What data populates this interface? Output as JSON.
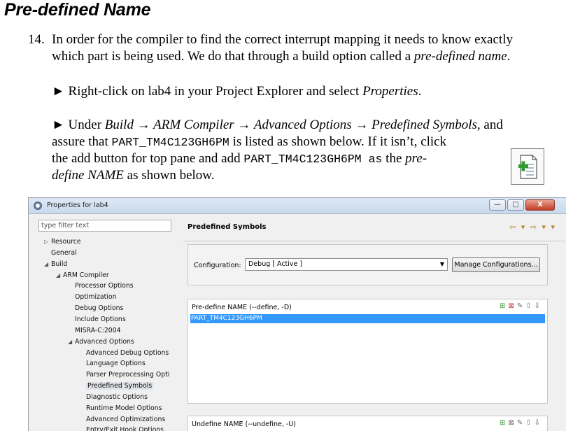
{
  "doc": {
    "heading": "Pre-defined Name",
    "step_number": "14.",
    "para1_line1": "In order for the compiler to find the correct interrupt mapping it needs to know exactly",
    "para1_line2_start": "which part is being used. We do that through a build option called a ",
    "para1_line2_em": "pre-defined name",
    "para1_line2_end": ".",
    "bullet1_start": "► Right-click on lab4 in your Project Explorer and select ",
    "bullet1_em": "Properties",
    "bullet1_end": ".",
    "bullet2_line1_start": "► Under ",
    "bullet2_path": "Build → ARM Compiler → Advanced Options → Predefined Symbols",
    "bullet2_line1_end": ", and",
    "bullet2_line2_start": "assure that ",
    "bullet2_symbol": "PART_TM4C123GH6PM",
    "bullet2_line2_end": " is listed as shown below. If it isn’t, click",
    "bullet2_line3_start": "the add button for top pane and add ",
    "bullet2_line3_symbol": "PART_TM4C123GH6PM as",
    "bullet2_line3_mid": " the ",
    "bullet2_line3_em": "pre-",
    "bullet2_line4_em": "define NAME",
    "bullet2_line4_end": " as shown below.",
    "add_icon": "add-document-icon"
  },
  "dialog": {
    "title": "Properties for lab4",
    "title_icon": "properties-gear-icon",
    "buttons": {
      "minimize": "—",
      "maximize": "□",
      "close": "X"
    },
    "filter_placeholder": "type filter text",
    "tree": [
      {
        "label": "Resource",
        "arrow": "▷"
      },
      {
        "label": "General",
        "arrow": ""
      },
      {
        "label": "Build",
        "arrow": "◢"
      },
      {
        "label": "ARM Compiler",
        "arrow": "◢"
      },
      {
        "label": "Processor Options",
        "arrow": ""
      },
      {
        "label": "Optimization",
        "arrow": ""
      },
      {
        "label": "Debug Options",
        "arrow": ""
      },
      {
        "label": "Include Options",
        "arrow": ""
      },
      {
        "label": "MISRA-C:2004",
        "arrow": ""
      },
      {
        "label": "Advanced Options",
        "arrow": "◢"
      },
      {
        "label": "Advanced Debug Options",
        "arrow": ""
      },
      {
        "label": "Language Options",
        "arrow": ""
      },
      {
        "label": "Parser Preprocessing Opti",
        "arrow": ""
      },
      {
        "label": "Predefined Symbols",
        "arrow": "",
        "selected": true
      },
      {
        "label": "Diagnostic Options",
        "arrow": ""
      },
      {
        "label": "Runtime Model Options",
        "arrow": ""
      },
      {
        "label": "Advanced Optimizations",
        "arrow": ""
      },
      {
        "label": "Entry/Exit Hook Options",
        "arrow": ""
      }
    ],
    "page_title": "Predefined Symbols",
    "nav_arrows": "⇦ ▾ ⇨ ▾ ▾",
    "config_label": "Configuration:",
    "config_value": "Debug  [ Active ]",
    "manage_button": "Manage Configurations...",
    "predefine_label": "Pre-define NAME (--define, -D)",
    "predefine_items": [
      "PART_TM4C123GH6PM"
    ],
    "undefine_label": "Undefine NAME (--undefine, -U)"
  }
}
